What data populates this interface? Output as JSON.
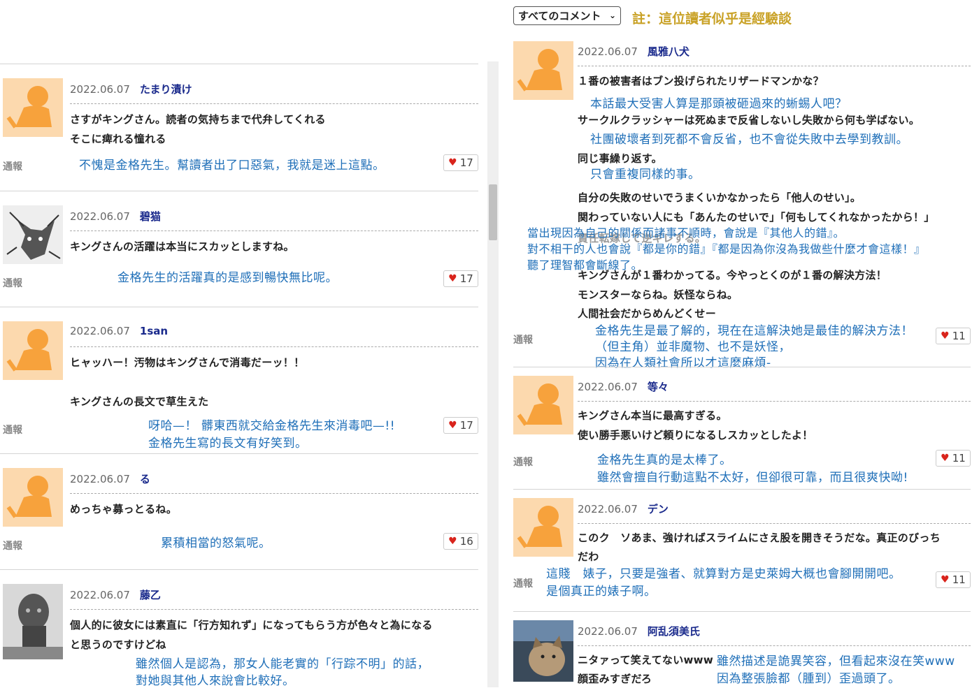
{
  "header": {
    "sort_label": "すべてのコメント",
    "note": "註：這位讀者似乎是經驗談"
  },
  "report_label": "通報",
  "left_comments": [
    {
      "date": "2022.06.07",
      "user": "たまり漬け",
      "lines": [
        "さすがキングさん。読者の気持ちまで代弁してくれる",
        "そこに痺れる憧れる"
      ],
      "translation": [
        "不愧是金格先生。幫讀者出了口惡氣，我就是迷上這點。"
      ],
      "likes": "17",
      "avatar": "default-avatar-icon"
    },
    {
      "date": "2022.06.07",
      "user": "碧猫",
      "lines": [
        "キングさんの活躍は本当にスカッとしますね。"
      ],
      "translation": [
        "金格先生的活躍真的是感到暢快無比呢。"
      ],
      "likes": "17",
      "avatar": "cat-illustration"
    },
    {
      "date": "2022.06.07",
      "user": "1san",
      "lines": [
        "ヒャッハー！汚物はキングさんで消毒だーッ！！",
        "キングさんの長文で草生えた"
      ],
      "translation": [
        "呀哈—！ 髒東西就交給金格先生來消毒吧—!!",
        "金格先生寫的長文有好笑到。"
      ],
      "likes": "17",
      "avatar": "default-avatar-icon"
    },
    {
      "date": "2022.06.07",
      "user": "る",
      "lines": [
        "めっちゃ募っとるね。"
      ],
      "translation": [
        "累積相當的怒氣呢。"
      ],
      "likes": "16",
      "avatar": "default-avatar-icon"
    },
    {
      "date": "2022.06.07",
      "user": "藤乙",
      "lines": [
        "個人的に彼女には素直に「行方知れず」になってもらう方が色々と為になる",
        "と思うのですけどね"
      ],
      "translation": [
        "雖然個人是認為，那女人能老實的「行踪不明」的話，",
        "對她與其他人來說會比較好。"
      ],
      "likes": "",
      "avatar": "statue-photo"
    }
  ],
  "right_comments": [
    {
      "date": "2022.06.07",
      "user": "風雅八犬",
      "blocks": [
        {
          "jp": "１番の被害者はブン投げられたリザードマンかな？",
          "tr": [
            "本話最大受害人算是那頭被砸過來的蜥蜴人吧？"
          ]
        },
        {
          "jp": "サークルクラッシャーは死ぬまで反省しないし失敗から何も学ばない。",
          "tr": [
            "社團破壞者到死都不會反省，也不會從失敗中去學到教訓。"
          ]
        },
        {
          "jp": "同じ事繰り返す。",
          "tr": [
            "只會重複同樣的事。"
          ]
        },
        {
          "jp": "自分の失敗のせいでうまくいかなかったら「他人のせい」。",
          "tr": []
        },
        {
          "jp": "関わっていない人にも「あんたのせいで」「何もしてくれなかったから！」",
          "tr": []
        },
        {
          "jp": "責任転嫁して逆ギレする。",
          "tr": []
        },
        {
          "jp": "キングさんが１番わかってる。今やっとくのが１番の解決方法！",
          "tr": []
        },
        {
          "jp": "モンスターならね。妖怪ならね。",
          "tr": []
        },
        {
          "jp": "人間社会だからめんどくせー",
          "tr": []
        }
      ],
      "overlay_tr": [
        "當出現因為自己的關係而諸事不順時，會說是『其他人的錯』。",
        "對不相干的人也會說『都是你的錯』『都是因為你沒為我做些什麼才會這樣！』",
        "聽了理智都會斷線了。"
      ],
      "end_tr": [
        "金格先生是最了解的，現在在這解決她是最佳的解決方法！",
        "（但主角）並非魔物、也不是妖怪，",
        "因為在人類社會所以才這麼麻煩-"
      ],
      "likes": "11"
    },
    {
      "date": "2022.06.07",
      "user": "等々",
      "lines": [
        "キングさん本当に最高すぎる。",
        "使い勝手悪いけど頼りになるしスカッとしたよ！"
      ],
      "translation": [
        "金格先生真的是太棒了。",
        "雖然會擅自行動這點不太好，但卻很可靠，而且很爽快呦!"
      ],
      "likes": "11"
    },
    {
      "date": "2022.06.07",
      "user": "デン",
      "lines": [
        "このク　ソあま、強ければスライムにさえ股を開きそうだな。真正のびっち",
        "だわ"
      ],
      "translation": [
        "這賤　婊子，只要是強者、就算對方是史萊姆大概也會腳開開吧。",
        "是個真正的婊子啊。"
      ],
      "likes": "11"
    },
    {
      "date": "2022.06.07",
      "user": "阿乱須美氏",
      "lines": [
        "ニタァって笑えてないwww",
        "顔歪みすぎだろ"
      ],
      "translation": [
        "雖然描述是詭異笑容，但看起來沒在笑www",
        "因為整張臉都（腫到）歪過頭了。"
      ],
      "likes": ""
    }
  ]
}
